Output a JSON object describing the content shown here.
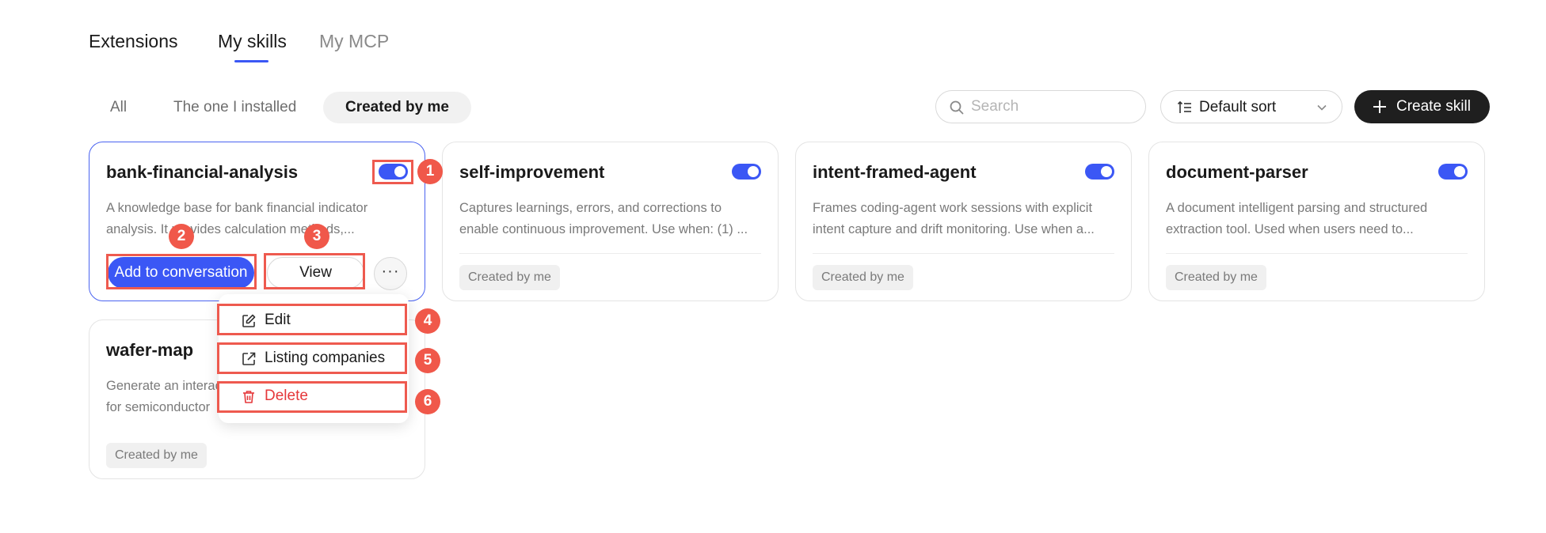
{
  "nav": {
    "tabs": [
      {
        "label": "Extensions"
      },
      {
        "label": "My skills"
      },
      {
        "label": "My MCP"
      }
    ]
  },
  "filters": [
    "All",
    "The one I installed",
    "Created by me"
  ],
  "search": {
    "placeholder": "Search",
    "value": ""
  },
  "sort": {
    "label": "Default sort"
  },
  "create": {
    "label": "Create skill"
  },
  "colors": {
    "accent": "#3b57f5",
    "annotation": "#f0584a",
    "danger": "#e5383b",
    "dark_button": "#1f1f1f"
  },
  "cards": [
    {
      "title": "bank-financial-analysis",
      "desc_line1": "A knowledge base for bank financial indicator",
      "desc_line2": "analysis. It provides calculation methods,...",
      "tag": "Created by me",
      "enabled": true
    },
    {
      "title": "self-improvement",
      "desc_line1": "Captures learnings, errors, and corrections to",
      "desc_line2": "enable continuous improvement. Use when: (1) ...",
      "tag": "Created by me",
      "enabled": true
    },
    {
      "title": "intent-framed-agent",
      "desc_line1": "Frames coding-agent work sessions with explicit",
      "desc_line2": "intent capture and drift monitoring. Use when a...",
      "tag": "Created by me",
      "enabled": true
    },
    {
      "title": "document-parser",
      "desc_line1": "A document intelligent parsing and structured",
      "desc_line2": "extraction tool. Used when users need to...",
      "tag": "Created by me",
      "enabled": true
    },
    {
      "title": "wafer-map",
      "desc_line1": "Generate an interactive wafer map",
      "desc_line2": "for semiconductor",
      "tag": "Created by me",
      "enabled": true
    }
  ],
  "actions": {
    "add_label": "Add to conversation",
    "view_label": "View",
    "more_label": "···"
  },
  "menu": {
    "items": [
      {
        "label": "Edit",
        "icon": "edit-icon"
      },
      {
        "label": "Listing companies",
        "icon": "external-link-icon"
      },
      {
        "label": "Delete",
        "icon": "trash-icon"
      }
    ]
  },
  "annotations": [
    "1",
    "2",
    "3",
    "4",
    "5",
    "6"
  ]
}
